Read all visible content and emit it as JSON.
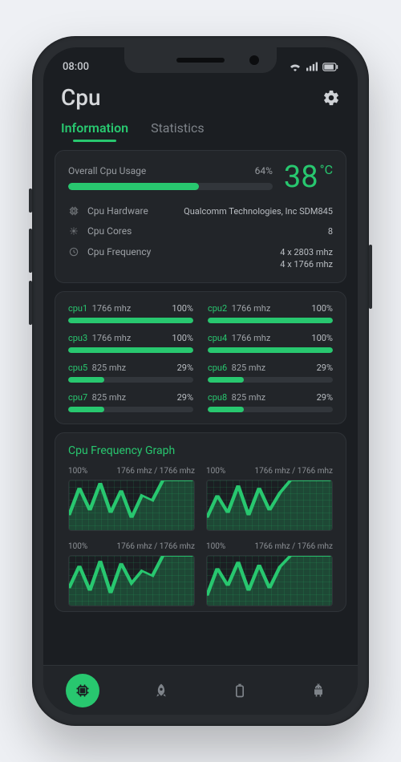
{
  "statusbar": {
    "time": "08:00"
  },
  "header": {
    "title": "Cpu"
  },
  "tabs": {
    "information": "Information",
    "statistics": "Statistics",
    "active": "information"
  },
  "overview": {
    "usage_label": "Overall Cpu Usage",
    "usage_pct_text": "64%",
    "usage_pct": 64,
    "temp_value": "38",
    "temp_unit": "°C",
    "hardware_label": "Cpu Hardware",
    "hardware_value": "Qualcomm Technologies, Inc SDM845",
    "cores_label": "Cpu Cores",
    "cores_value": "8",
    "freq_label": "Cpu Frequency",
    "freq_value_1": "4 x 2803 mhz",
    "freq_value_2": "4 x 1766 mhz"
  },
  "cores": [
    {
      "name": "cpu1",
      "freq": "1766 mhz",
      "pct_text": "100%",
      "pct": 100
    },
    {
      "name": "cpu2",
      "freq": "1766 mhz",
      "pct_text": "100%",
      "pct": 100
    },
    {
      "name": "cpu3",
      "freq": "1766 mhz",
      "pct_text": "100%",
      "pct": 100
    },
    {
      "name": "cpu4",
      "freq": "1766 mhz",
      "pct_text": "100%",
      "pct": 100
    },
    {
      "name": "cpu5",
      "freq": "825 mhz",
      "pct_text": "29%",
      "pct": 29
    },
    {
      "name": "cpu6",
      "freq": "825 mhz",
      "pct_text": "29%",
      "pct": 29
    },
    {
      "name": "cpu7",
      "freq": "825 mhz",
      "pct_text": "29%",
      "pct": 29
    },
    {
      "name": "cpu8",
      "freq": "825 mhz",
      "pct_text": "29%",
      "pct": 29
    }
  ],
  "graph_section": {
    "title": "Cpu Frequency Graph",
    "items": [
      {
        "pct": "100%",
        "freq": "1766 mhz / 1766 mhz"
      },
      {
        "pct": "100%",
        "freq": "1766 mhz / 1766 mhz"
      },
      {
        "pct": "100%",
        "freq": "1766 mhz / 1766 mhz"
      },
      {
        "pct": "100%",
        "freq": "1766 mhz / 1766 mhz"
      }
    ]
  },
  "chart_data": {
    "type": "line",
    "note": "Four small CPU-frequency sparkline panels. Y axis 0–100% utilization, recent history; values estimated from gridlines.",
    "ylim": [
      0,
      100
    ],
    "series": [
      {
        "name": "cpu-graph-1",
        "values": [
          30,
          85,
          40,
          95,
          35,
          80,
          25,
          70,
          60,
          100,
          100,
          100,
          100
        ]
      },
      {
        "name": "cpu-graph-2",
        "values": [
          25,
          70,
          35,
          90,
          30,
          85,
          40,
          75,
          100,
          100,
          100,
          100,
          100
        ]
      },
      {
        "name": "cpu-graph-3",
        "values": [
          35,
          80,
          30,
          90,
          25,
          85,
          45,
          70,
          60,
          100,
          100,
          100,
          100
        ]
      },
      {
        "name": "cpu-graph-4",
        "values": [
          20,
          75,
          40,
          88,
          30,
          82,
          35,
          78,
          100,
          100,
          100,
          100,
          100
        ]
      }
    ]
  },
  "colors": {
    "accent": "#28c76f",
    "bg": "#1b1e22",
    "card": "#222529"
  }
}
